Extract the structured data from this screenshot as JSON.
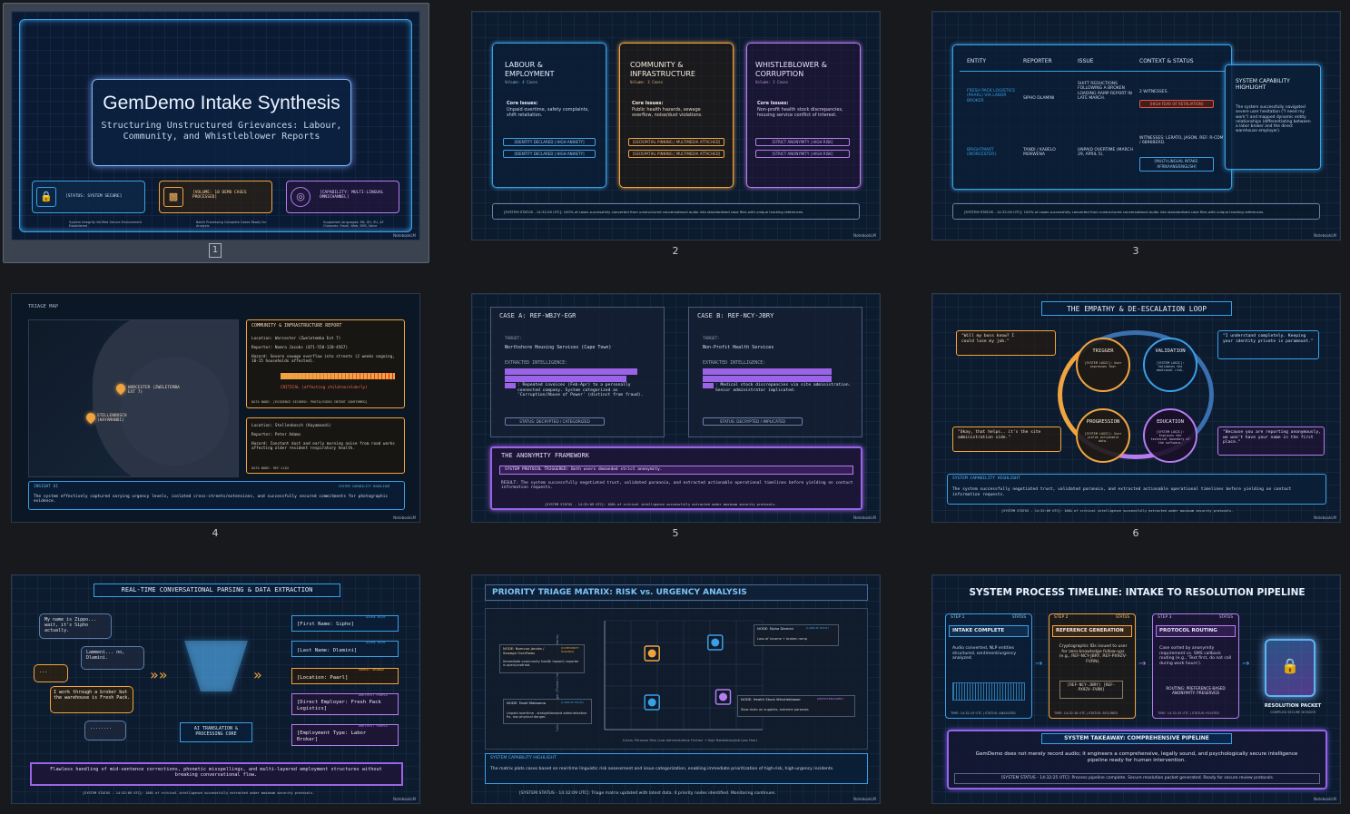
{
  "slides": [
    {
      "number": "1",
      "title": "GemDemo Intake Synthesis",
      "subtitle": "Structuring Unstructured Grievances: Labour, Community, and Whistleblower Reports",
      "cards": [
        {
          "label": "[STATUS: SYSTEM SECURE]",
          "note": "System Integrity Verified Secure Environment Established",
          "icon": "lock-icon"
        },
        {
          "label": "[VOLUME: 10 DEMO CASES PROCESSED]",
          "note": "Batch Processing Complete Cases Ready for Analysis",
          "icon": "bar-chart-icon"
        },
        {
          "label": "[CAPABILITY: MULTI-LINGUAL OMNICHANNEL]",
          "note": "Supported Languages: EN, XH, ZU, AF Channels: Email, Web, SMS, Voice",
          "icon": "globe-icon"
        }
      ]
    },
    {
      "number": "2",
      "columns": [
        {
          "title": "LABOUR & EMPLOYMENT",
          "volume": "Volume: 4 Cases",
          "issues_label": "Core Issues:",
          "issues": "Unpaid overtime, safety complaints, shift retaliation.",
          "tags": [
            "[IDENTITY DECLARED | HIGH ANXIETY]",
            "[IDENTITY DECLARED | HIGH ANXIETY]"
          ]
        },
        {
          "title": "COMMUNITY & INFRASTRUCTURE",
          "volume": "Volume: 3 Cases",
          "issues_label": "Core Issues:",
          "issues": "Public health hazards, sewage overflow, noise/dust violations.",
          "tags": [
            "[GEOSPATIAL PINNING | MULTIMEDIA ATTACHED]",
            "[GEOSPATIAL PINNING | MULTIMEDIA ATTACHED]"
          ]
        },
        {
          "title": "WHISTLEBLOWER & CORRUPTION",
          "volume": "Volume: 2 Cases",
          "issues_label": "Core Issues:",
          "issues": "Non-profit health stock discrepancies, housing service conflict of interest.",
          "tags": [
            "[STRICT ANONYMITY | HIGH RISK]",
            "[STRICT ANONYMITY | HIGH RISK]"
          ]
        }
      ],
      "status": "[SYSTEM STATUS - 14:32:09 UTC]: 100% of cases successfully converted from unstructured conversational audio into standardized case files with unique tracking references."
    },
    {
      "number": "3",
      "headers": [
        "ENTITY",
        "REPORTER",
        "ISSUE",
        "CONTEXT & STATUS"
      ],
      "rows": [
        [
          "FRESH PACK LOGISTICS (PAARL) VIA LABOR BROKER",
          "SIPHO DLAMINI",
          "SHIFT REDUCTIONS FOLLOWING A BROKEN LOADING RAMP REPORT IN LATE MARCH.",
          "2 WITNESSES.",
          "[HIGH FEAR OF RETALIATION]"
        ],
        [
          "BRIGHTMART (WORCESTER)",
          "TANDI / KABELO MOKWENA",
          "UNPAID OVERTIME (MARCH 29, APRIL 5).",
          "WITNESSES: LERATO, JASON. REF: R-CDM / 6896BERD.",
          "[MULTI-LINGUAL INTAKE: AFRIKAANS/ENGLISH]"
        ]
      ],
      "highlight_title": "SYSTEM CAPABILITY HIGHLIGHT",
      "highlight": "The system successfully navigated severe user hesitation (\"I need my work\") and mapped dynamic entity relationships (differentiating between a labor broker and the direct warehouse employer).",
      "status": "[SYSTEM STATUS - 14:32:09 UTC]: 100% of cases successfully converted from unstructured conversational audio into standardized case files with unique tracking references."
    },
    {
      "number": "4",
      "map_title": "TRIAGE MAP",
      "pins": [
        {
          "label": "WORCESTER (ZWELETEMBA EXT 7)",
          "color": "#f0a440"
        },
        {
          "label": "STELLENBOSCH (KAYAMANDI)",
          "color": "#f0a440"
        }
      ],
      "report1": {
        "title": "COMMUNITY & INFRASTRUCTURE REPORT",
        "location": "Location: Worcester (Zweletemba Ext 7)",
        "reporter": "Reporter: Nomra Jacobs (071-550-120-4567)",
        "hazard": "Hazard: Severe sewage overflow into streets (2 weeks ongoing, 10-15 households affected).",
        "critical": "CRITICAL (affecting children/elderly)",
        "note": "DATA NODE: [EVIDENCE SECURED: PHOTO/VIDEO INTENT CONFIRMED]"
      },
      "report2": {
        "location": "Location: Stellenbosch (Kayamandi)",
        "reporter": "Reporter: Peter Adams",
        "hazard": "Hazard: Constant dust and early morning noise from road works affecting older resident respiratory health.",
        "note": "DATA NODE: REF-CL62"
      },
      "insight_title": "INSIGHT UI",
      "insight_tag": "SYSTEM CAPABILITY HIGHLIGHT",
      "insight": "The system effectively captured varying urgency levels, isolated cross-streets/extensions, and successfully secured commitments for photographic evidence."
    },
    {
      "number": "5",
      "case_a": {
        "title": "CASE A: REF-WBJY-EGR",
        "target_label": "TARGET:",
        "target": "Northshore Housing Services (Cape Town)",
        "intel_label": "EXTRACTED INTELLIGENCE:",
        "intel": ": Repeated invoices (Feb-Apr) to a personally connected company. System categorized as 'Corruption/Abuse of Power' (distinct from fraud).",
        "status": "STATUS: DECRYPTED / CATEGORIZED"
      },
      "case_b": {
        "title": "CASE B: REF-NCY-JBRY",
        "target_label": "TARGET:",
        "target": "Non-Profit Health Services",
        "intel_label": "EXTRACTED INTELLIGENCE:",
        "intel": ": Medical stock discrepancies via site administration. Senior administrator implicated.",
        "status": "STATUS: DECRYPTED / IMPLICATED"
      },
      "framework_title": "THE ANONYMITY FRAMEWORK",
      "protocol": "SYSTEM PROTOCOL TRIGGERED: Both users demanded strict anonymity.",
      "result": "RESULT: The system successfully negotiated trust, validated paranoia, and extracted actionable operational timelines before yielding on contact information requests.",
      "status": "[SYSTEM STATUS - 14:32:09 UTC]: 100% of critical intelligence successfully extracted under maximum security protocols."
    },
    {
      "number": "6",
      "title": "THE EMPATHY & DE-ESCALATION LOOP",
      "quotes": [
        "\"Will my boss know? I could lose my job.\"",
        "\"I understand completely. Keeping your identity private is paramount.\"",
        "\"Okay, that helps.. it's the site administration side.\"",
        "\"Because you are reporting anonymously, we won't have your name in the first place.\""
      ],
      "nodes": [
        {
          "title": "TRIGGER",
          "logic": "[SYSTEM LOGIC]: User expresses fear"
        },
        {
          "title": "VALIDATION",
          "logic": "[SYSTEM LOGIC]: Validates the emotional risk."
        },
        {
          "title": "PROGRESSION",
          "logic": "[SYSTEM LOGIC]: User yields actionable data."
        },
        {
          "title": "EDUCATION",
          "logic": "[SYSTEM LOGIC]: Explains the technical boundary of the software."
        }
      ],
      "highlight_title": "SYSTEM CAPABILITY HIGHLIGHT",
      "highlight": "The system successfully negotiated trust, validated paranoia, and extracted actionable operational timelines before yielding on contact information requests.",
      "status": "[SYSTEM STATUS - 14:32:09 UTC]: 100% of critical intelligence successfully extracted under maximum security protocols."
    },
    {
      "number": "7",
      "title": "REAL-TIME CONVERSATIONAL PARSING & DATA EXTRACTION",
      "bubbles": [
        "My name is Zippo... wait, it's Sipho actually.",
        "Lammeni... no, Dlamini.",
        "...",
        "I work through a broker but the warehouse is Fresh Pack.",
        "........"
      ],
      "core": "AI TRANSLATION & PROCESSING CORE",
      "fields": [
        {
          "text": "[First Name: Sipho]",
          "tag": "AZURE BLUE",
          "color": "#3aa0e6"
        },
        {
          "text": "[Last Name: Dlamini]",
          "tag": "AZURE BLUE",
          "color": "#3aa0e6"
        },
        {
          "text": "[Location: Paarl]",
          "tag": "SUNSET ORANGE",
          "color": "#f0a440"
        },
        {
          "text": "[Direct Employer: Fresh Pack Logistics]",
          "tag": "AMETHYST PURPLE",
          "color": "#b67cf0"
        },
        {
          "text": "[Employment Type: Labor Broker]",
          "tag": "AMETHYST PURPLE",
          "color": "#b67cf0"
        }
      ],
      "footer": "Flawless handling of mid-sentence corrections, phonetic misspellings, and multi-layered employment structures without breaking conversational flow.",
      "status": "[SYSTEM STATUS - 14:32:09 UTC]: 100% of critical intelligence successfully extracted under maximum security protocols."
    },
    {
      "number": "8",
      "title": "PRIORITY TRIAGE MATRIX: RISK vs. URGENCY ANALYSIS",
      "y_axis": "Y-Axis: Physical Danger (Threat / Immediate physical harm)",
      "x_axis": "X-Axis: Personal Risk (Low Administrative Friction → High Retaliation/Job Loss Fear)",
      "nodes": [
        {
          "label": "NODE: Nomvuo Jacobs / Sewage Overflows",
          "tag": "[COMMUNITY HAZARD]",
          "desc": "Immediate community health hazard; reporter is open/unafraid.",
          "color": "#f0a440"
        },
        {
          "label": "NODE: Sipho Dlamini",
          "tag": "[LABOUR ISSUE]",
          "desc": "Loss of income + broken ramp",
          "color": "#3aa0e6"
        },
        {
          "label": "NODE: Tandi Makaomo",
          "tag": "[LABOUR ISSUE]",
          "desc": "Unpaid overtime - straightforward administrative fix, low physical danger.",
          "color": "#3aa0e6"
        },
        {
          "label": "NODE: Health Stock Whistleblower",
          "tag": "[WHISTLEBLOWER]",
          "desc": "Slow drain on supplies, extreme paranoia",
          "color": "#b67cf0"
        }
      ],
      "chart_data": {
        "type": "scatter",
        "xlabel": "X-Axis: Personal Risk (Low Administrative Friction → High Retaliation/Job Loss Fear)",
        "ylabel": "Y-Axis: Physical Danger (Threat / Immediate physical harm)",
        "series": [
          {
            "name": "NODE: Nomvuo Jacobs / Sewage Overflows",
            "values": [
              [
                0.3,
                0.7
              ]
            ]
          },
          {
            "name": "NODE: Sipho Dlamini",
            "values": [
              [
                0.7,
                0.8
              ]
            ]
          },
          {
            "name": "NODE: Tandi Makaomo",
            "values": [
              [
                0.3,
                0.25
              ]
            ]
          },
          {
            "name": "NODE: Health Stock Whistleblower",
            "values": [
              [
                0.75,
                0.3
              ]
            ]
          }
        ]
      },
      "highlight_title": "SYSTEM CAPABILITY HIGHLIGHT",
      "highlight": "The matrix plots cases based on real-time linguistic risk assessment and issue categorization, enabling immediate prioritization of high-risk, high-urgency incidents.",
      "status": "[SYSTEM STATUS - 14:32:09 UTC]: Triage matrix updated with latest data. 4 priority nodes identified. Monitoring continues."
    },
    {
      "number": "9",
      "title": "SYSTEM PROCESS TIMELINE: INTAKE TO RESOLUTION PIPELINE",
      "steps": [
        {
          "step": "STEP 1",
          "status": "STATUS",
          "title": "INTAKE COMPLETE",
          "body": "Audio converted, NLP entities structured, sentiment/urgency analyzed.",
          "foot": "TIME: 14:32:15 UTC | STATUS: ANALYZED"
        },
        {
          "step": "STEP 2",
          "status": "STATUS",
          "title": "REFERENCE GENERATION",
          "body": "Cryptographic IDs issued to user for zero-knowledge follow-ups (e.g., REF-NCY-JBRY, REF-PX9ZV-FVRN).",
          "refs": "[REF-NCY-JBRY] [REF-PX9ZV-FVRN]",
          "foot": "TIME: 14:32:18 UTC | STATUS: SECURED"
        },
        {
          "step": "STEP 3",
          "status": "STATUS",
          "title": "PROTOCOL ROUTING",
          "body": "Case sorted by anonymity requirement vs. SMS callback routing (e.g., 'Text first, do not call during work hours').",
          "routing": "ROUTING: PREFERENCE-BASED ANONYMITY: PRESERVED",
          "foot": "TIME: 14:32:25 UTC | STATUS: ROUTED"
        }
      ],
      "packet": "RESOLUTION PACKET",
      "packet_sub": "COMPILED SECURE DOSSIER",
      "takeaway_title": "SYSTEM TAKEAWAY: COMPREHENSIVE PIPELINE",
      "takeaway": "GemDemo does not merely record audio; it engineers a comprehensive, legally sound, and psychologically secure intelligence pipeline ready for human intervention.",
      "status": "[SYSTEM STATUS - 14:32:25 UTC]: Process pipeline complete. Secure resolution packet generated. Ready for secure review protocols."
    }
  ],
  "watermark": "NotebookLM",
  "colors": {
    "azure": "#3aa0e6",
    "orange": "#f0a440",
    "purple": "#b67cf0",
    "bg": "#17191d"
  }
}
